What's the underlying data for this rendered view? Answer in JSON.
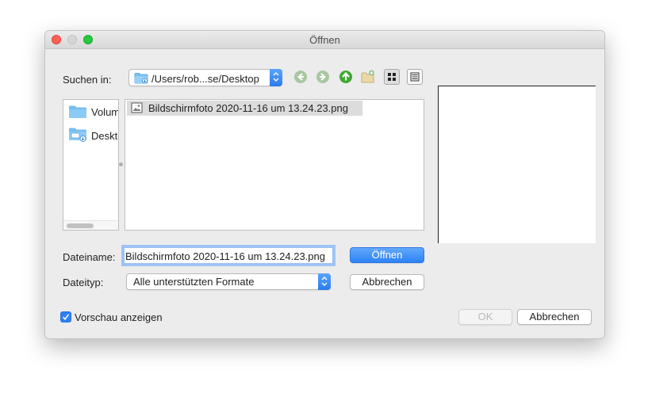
{
  "window": {
    "title": "Öffnen"
  },
  "look_in": {
    "label": "Suchen in:",
    "path": "/Users/rob...se/Desktop"
  },
  "toolbar": {
    "back_icon": "arrow-left-icon",
    "forward_icon": "arrow-right-icon",
    "up_icon": "arrow-up-icon",
    "new_folder_icon": "new-folder-icon",
    "detail_icon": "detail-view-icon",
    "list_icon": "list-view-icon"
  },
  "sidebar": {
    "items": [
      {
        "label": "Volumes"
      },
      {
        "label": "Desktop"
      }
    ]
  },
  "files": [
    {
      "name": "Bildschirmfoto 2020-11-16 um 13.24.23.png",
      "selected": true
    }
  ],
  "filename": {
    "label": "Dateiname:",
    "value": "Bildschirmfoto 2020-11-16 um 13.24.23.png"
  },
  "filetype": {
    "label": "Dateityp:",
    "value": "Alle unterstützten Formate"
  },
  "buttons": {
    "open": "Öffnen",
    "cancel_inner": "Abbrechen",
    "ok": "OK",
    "cancel": "Abbrechen"
  },
  "preview_checkbox": {
    "label": "Vorschau anzeigen",
    "checked": true
  },
  "colors": {
    "accent": "#2e82f5",
    "nav_green": "#3ea833",
    "window_bg": "#ececec"
  }
}
